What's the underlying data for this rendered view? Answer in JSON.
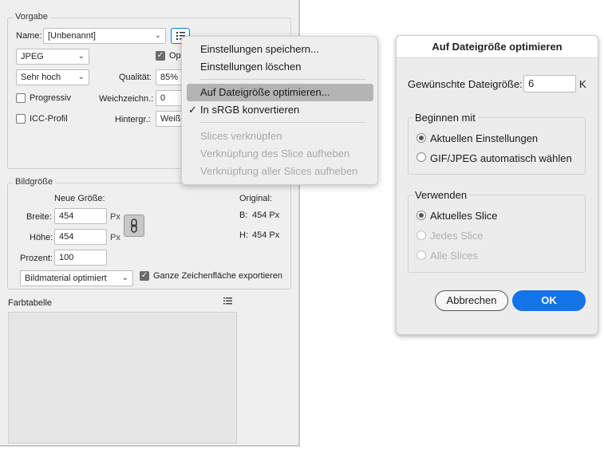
{
  "left_panel": {
    "preset_group_title": "Vorgabe",
    "name_label": "Name:",
    "name_value": "[Unbenannt]",
    "format_value": "JPEG",
    "optimized_label": "Opt",
    "quality_preset_value": "Sehr hoch",
    "quality_label": "Qualität:",
    "quality_value": "85%",
    "progressive_label": "Progressiv",
    "blur_label": "Weichzeichn.:",
    "blur_value": "0",
    "icc_label": "ICC-Profil",
    "matte_label": "Hintergr.:",
    "matte_value": "Weiß",
    "image_size_title": "Bildgröße",
    "new_size_label": "Neue Größe:",
    "original_label": "Original:",
    "width_label": "Breite:",
    "width_value": "454",
    "height_label": "Höhe:",
    "height_value": "454",
    "unit_px": "Px",
    "original_w_label": "B:",
    "original_w_value": "454 Px",
    "original_h_label": "H:",
    "original_h_value": "454 Px",
    "percent_label": "Prozent:",
    "percent_value": "100",
    "resample_value": "Bildmaterial optimiert",
    "export_artboard_label": "Ganze Zeichenfläche exportieren",
    "color_table_title": "Farbtabelle"
  },
  "menu": {
    "items": [
      {
        "label": "Einstellungen speichern...",
        "enabled": true
      },
      {
        "label": "Einstellungen löschen",
        "enabled": true
      },
      {
        "label": "Auf Dateigröße optimieren...",
        "enabled": true,
        "highlighted": true
      },
      {
        "label": "In sRGB konvertieren",
        "enabled": true,
        "checked": true
      },
      {
        "label": "Slices verknüpfen",
        "enabled": false
      },
      {
        "label": "Verknüpfung des Slice aufheben",
        "enabled": false
      },
      {
        "label": "Verknüpfung aller Slices aufheben",
        "enabled": false
      }
    ],
    "checkmark": "✓"
  },
  "dialog": {
    "title": "Auf Dateigröße optimieren",
    "target_size_label": "Gewünschte Dateigröße:",
    "target_size_value": "6",
    "target_size_unit": "K",
    "start_with_title": "Beginnen mit",
    "start_current": "Aktuellen Einstellungen",
    "start_auto": "GIF/JPEG automatisch wählen",
    "use_title": "Verwenden",
    "use_current_slice": "Aktuelles Slice",
    "use_each_slice": "Jedes Slice",
    "use_all_slices": "Alle Slices",
    "cancel_label": "Abbrechen",
    "ok_label": "OK"
  },
  "colors": {
    "panel_bg": "#efefef",
    "accent_blue": "#1473e6",
    "menu_highlight": "#b4b4b4"
  },
  "icons": [
    "chevron-down-icon",
    "menu-list-icon",
    "link-icon",
    "checkmark-icon"
  ]
}
